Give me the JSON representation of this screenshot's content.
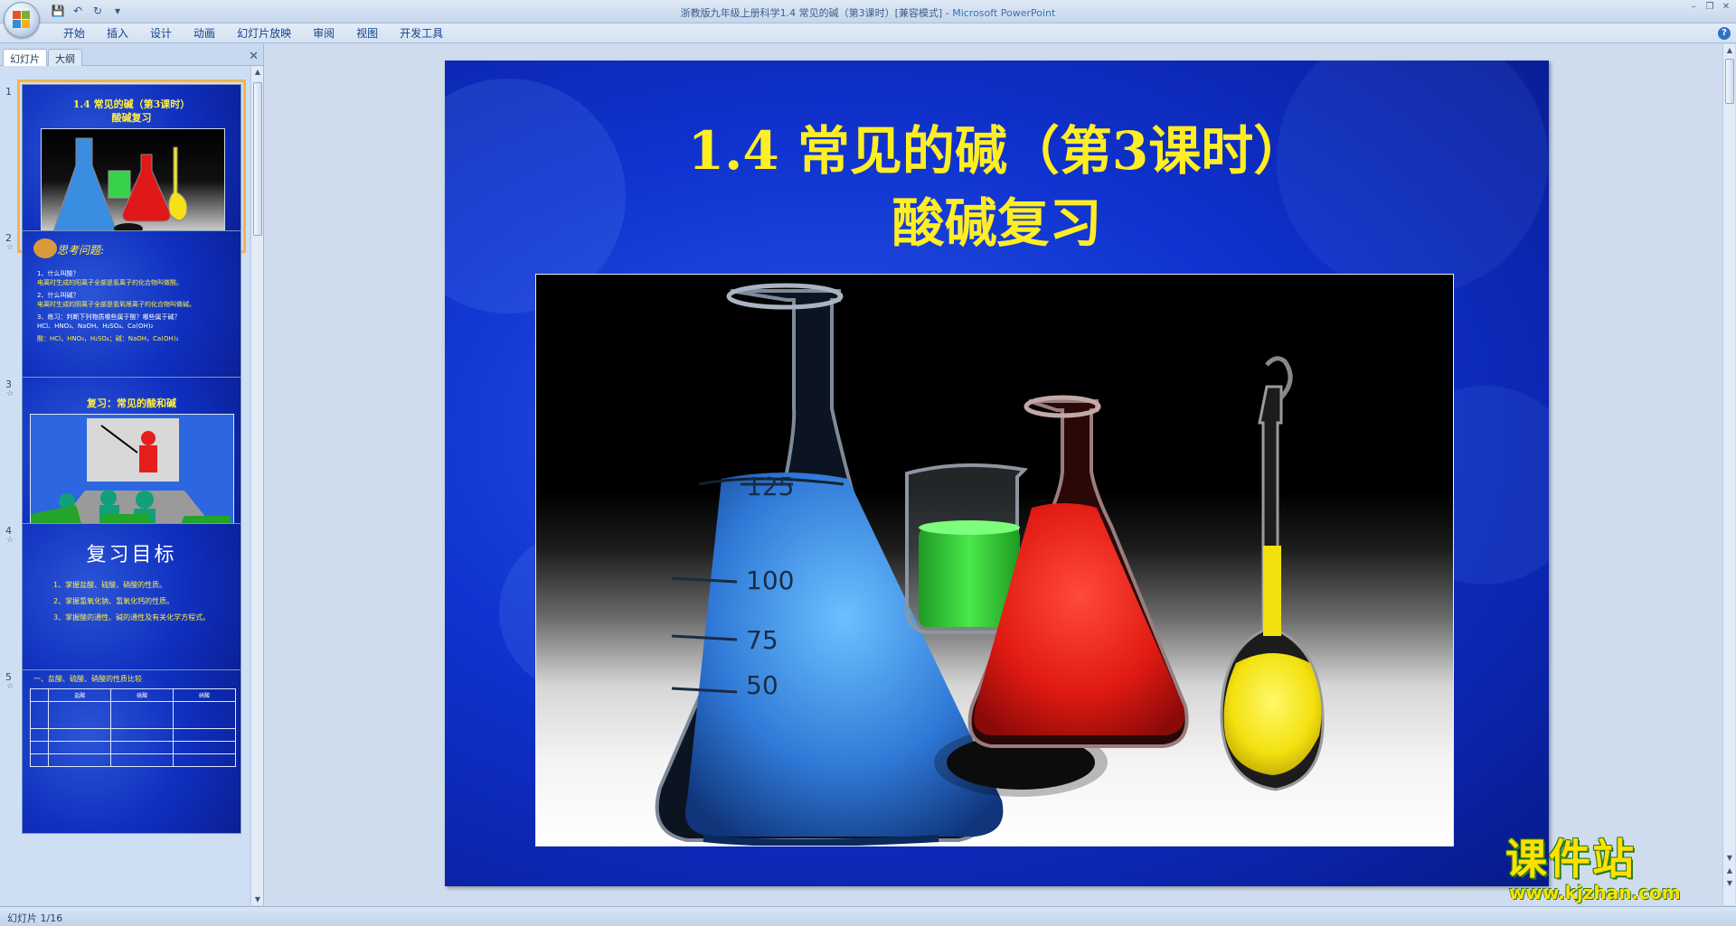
{
  "window": {
    "title": "浙教版九年级上册科学1.4 常见的碱（第3课时）[兼容模式] - ",
    "app_name": "Microsoft PowerPoint"
  },
  "ribbon": {
    "tabs": [
      "开始",
      "插入",
      "设计",
      "动画",
      "幻灯片放映",
      "审阅",
      "视图",
      "开发工具"
    ]
  },
  "panel": {
    "tabs": [
      "幻灯片",
      "大纲"
    ]
  },
  "thumbnails": [
    {
      "num": "1",
      "title_line1": "1.4 常见的碱（第3课时）",
      "title_line2": "酸碱复习"
    },
    {
      "num": "2",
      "title": "思考问题:",
      "lines": [
        "1、什么叫酸？",
        "电离时生成的阳离子全部是氢离子的化合物叫做酸。",
        "2、什么叫碱？",
        "电离时生成的阴离子全部是氢氧根离子的化合物叫做碱。",
        "3、练习：判断下列物质哪些属于酸？哪些属于碱？",
        "HCl、HNO₃、NaOH、H₂SO₄、Ca(OH)₂",
        "酸：HCl，HNO₃，H₂SO₄；碱：NaOH，Ca(OH)₂"
      ]
    },
    {
      "num": "3",
      "title": "复习：常见的酸和碱"
    },
    {
      "num": "4",
      "title": "复习目标",
      "lines": [
        "1、掌握盐酸、硫酸、硝酸的性质。",
        "2、掌握氢氧化钠、氢氧化钙的性质。",
        "3、掌握酸的通性、碱的通性及有关化学方程式。"
      ]
    },
    {
      "num": "5",
      "title": "一、盐酸、硫酸、硝酸的性质比较",
      "headers": [
        "",
        "盐酸",
        "硫酸",
        "硝酸"
      ]
    }
  ],
  "slide": {
    "title_line1": "1.4 常见的碱（第3课时）",
    "title_line2": "酸碱复习",
    "beaker_marks": [
      "125",
      "100",
      "75",
      "50"
    ]
  },
  "watermark": {
    "text": "课件站",
    "url": "www.kjzhan.com"
  },
  "status": {
    "slide_indicator": "幻灯片 1/16"
  },
  "colors": {
    "slide_bg": "#1033cf",
    "title_yellow": "#ffee22",
    "selected_outline": "#f6b24a"
  }
}
